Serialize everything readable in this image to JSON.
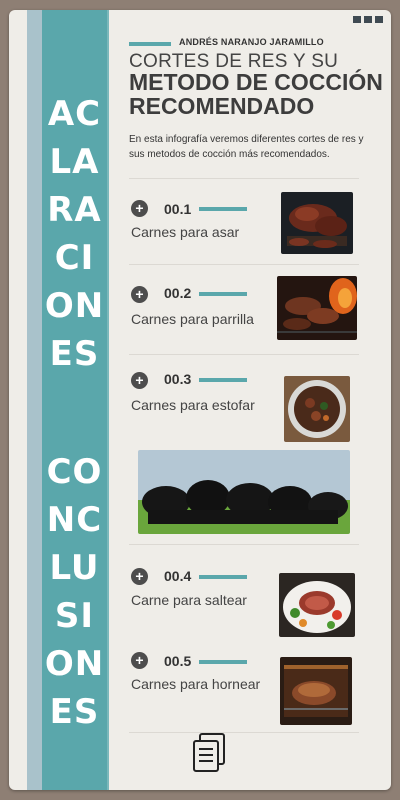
{
  "author": "ANDRÉS NARANJO JARAMILLO",
  "title_line1": "CORTES DE RES Y SU",
  "title_line2": "METODO DE COCCIÓN",
  "title_line3": "RECOMENDADO",
  "description": "En esta infografía veremos diferentes cortes de res y sus metodos de cocción más recomendados.",
  "side_sections": {
    "aclaraciones": [
      "AC",
      "LA",
      "RA",
      "CI",
      "ON",
      "ES"
    ],
    "conclusiones": [
      "CO",
      "NC",
      "LU",
      "SI",
      "ON",
      "ES"
    ]
  },
  "items": [
    {
      "number": "00.1",
      "label": "Carnes para asar",
      "image_icon": "grilled-ribs-photo"
    },
    {
      "number": "00.2",
      "label": "Carnes para parrilla",
      "image_icon": "barbecue-grill-photo"
    },
    {
      "number": "00.3",
      "label": "Carnes para estofar",
      "image_icon": "stew-pot-photo"
    },
    {
      "number": "00.4",
      "label": "Carne para saltear",
      "image_icon": "sliced-steak-plate-photo"
    },
    {
      "number": "00.5",
      "label": "Carnes para hornear",
      "image_icon": "oven-roast-photo"
    }
  ],
  "colors": {
    "accent": "#5aa7ab",
    "stripe_light": "#a9c2cb",
    "card": "#efede8",
    "background": "#8e7f74",
    "text_dark": "#3d3d3d"
  }
}
